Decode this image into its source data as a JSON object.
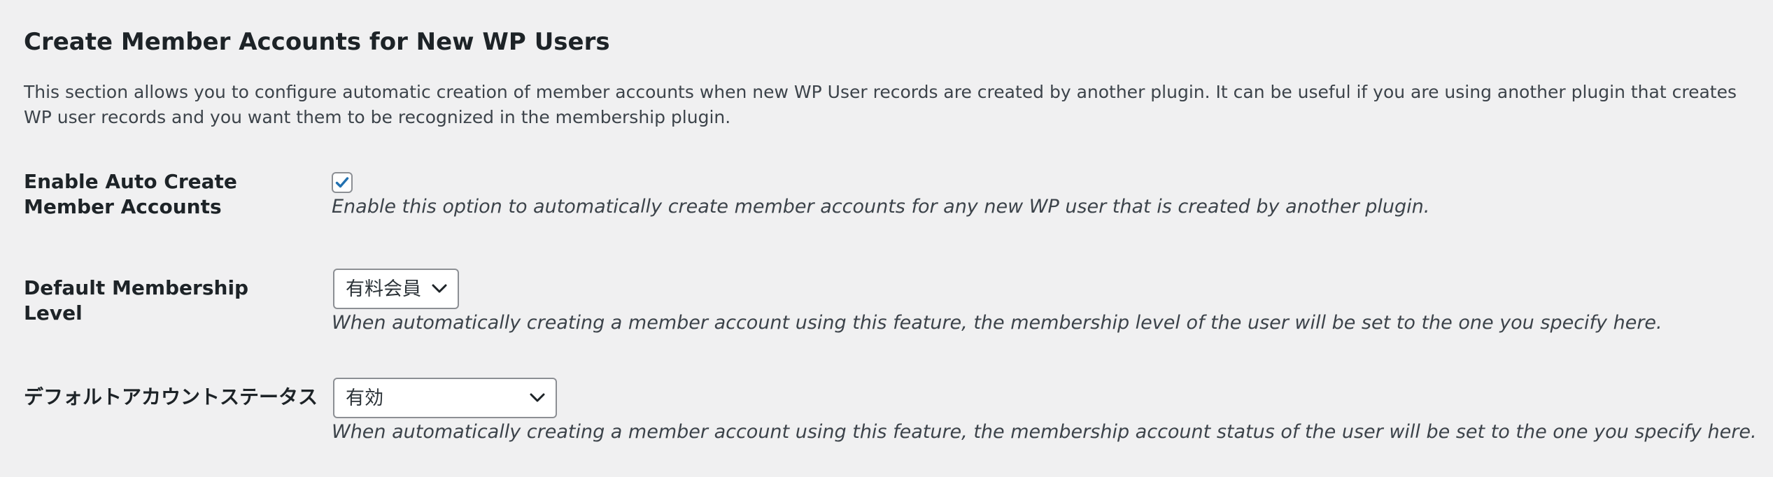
{
  "section": {
    "title": "Create Member Accounts for New WP Users",
    "description": "This section allows you to configure automatic creation of member accounts when new WP User records are created by another plugin. It can be useful if you are using another plugin that creates WP user records and you want them to be recognized in the membership plugin."
  },
  "rows": {
    "enable_auto_create": {
      "label": "Enable Auto Create Member Accounts",
      "checked": true,
      "description": "Enable this option to automatically create member accounts for any new WP user that is created by another plugin."
    },
    "default_level": {
      "label": "Default Membership Level",
      "selected": "有料会員",
      "description": "When automatically creating a member account using this feature, the membership level of the user will be set to the one you specify here."
    },
    "default_status": {
      "label": "デフォルトアカウントステータス",
      "selected": "有効",
      "description": "When automatically creating a member account using this feature, the membership account status of the user will be set to the one you specify here."
    }
  },
  "colors": {
    "checkmark": "#2271b1",
    "background": "#f0f0f1",
    "text": "#1d2327"
  },
  "icons": {
    "checkbox": "check-icon",
    "select": "chevron-down-icon"
  }
}
